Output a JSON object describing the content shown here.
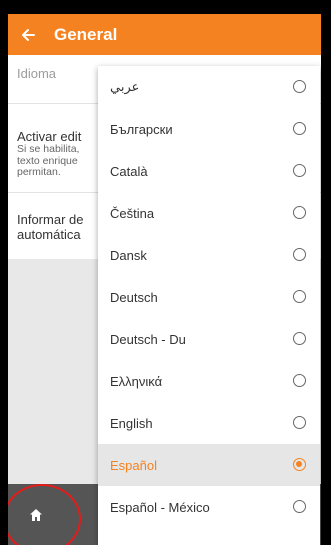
{
  "colors": {
    "accent": "#f58220",
    "app_bar": "#f58220",
    "nav_bar": "#555555",
    "highlight_circle": "#e41c1c"
  },
  "app_bar": {
    "title": "General",
    "back_icon": "arrow-left-icon"
  },
  "settings": {
    "language_label": "Idioma",
    "rich_text_label": "Activar edit",
    "rich_text_desc": "Si se habilita, texto enrique permitan.",
    "report_label": "Informar de automática"
  },
  "language_dialog": {
    "options": [
      {
        "label": "عربي",
        "selected": false
      },
      {
        "label": "Български",
        "selected": false
      },
      {
        "label": "Català",
        "selected": false
      },
      {
        "label": "Čeština",
        "selected": false
      },
      {
        "label": "Dansk",
        "selected": false
      },
      {
        "label": "Deutsch",
        "selected": false
      },
      {
        "label": "Deutsch - Du",
        "selected": false
      },
      {
        "label": "Ελληνικά",
        "selected": false
      },
      {
        "label": "English",
        "selected": false
      },
      {
        "label": "Español",
        "selected": true
      },
      {
        "label": "Español - México",
        "selected": false
      }
    ]
  },
  "bottom_nav": {
    "home_icon": "home-icon"
  }
}
